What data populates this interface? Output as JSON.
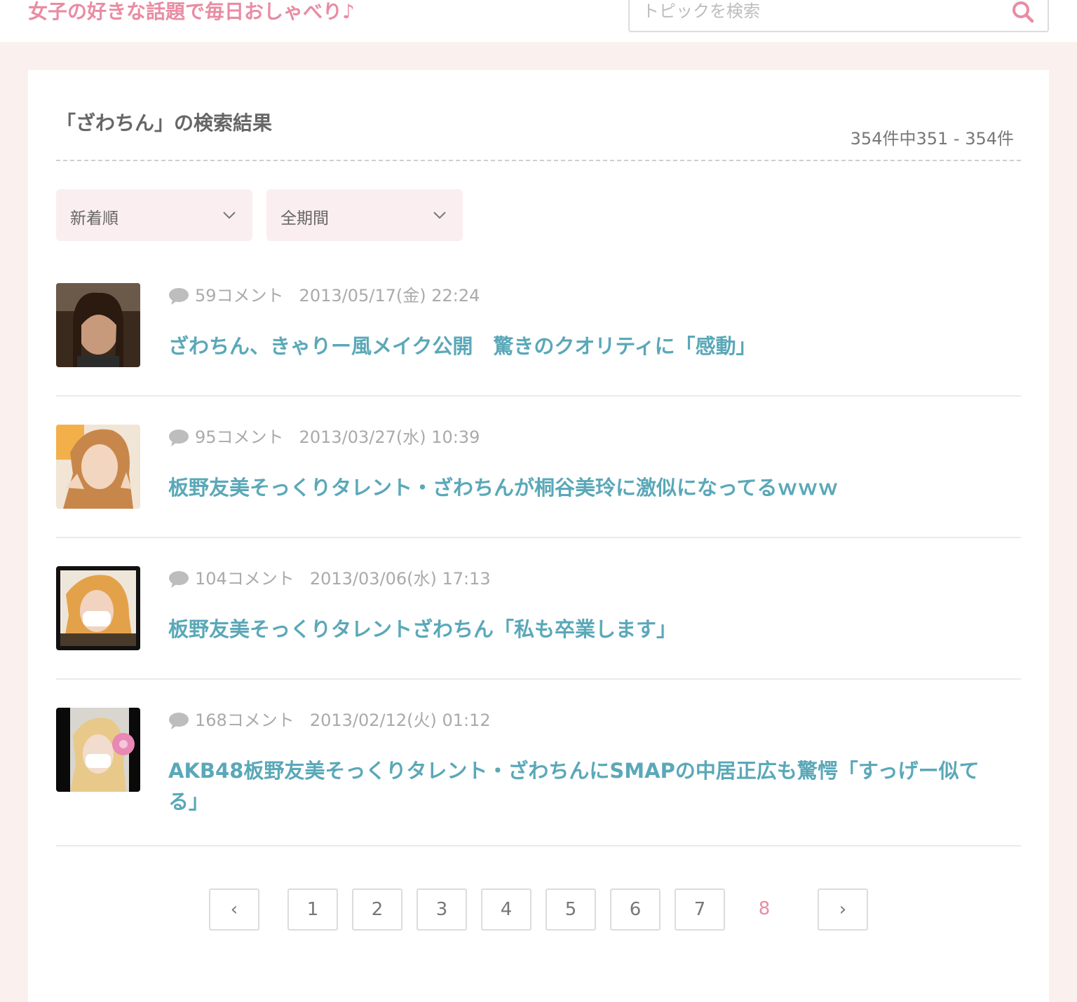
{
  "header": {
    "tagline": "女子の好きな話題で毎日おしゃべり♪",
    "search_placeholder": "トピックを検索",
    "search_icon": "search-icon"
  },
  "results": {
    "title": "「ざわちん」の検索結果",
    "count": "354件中351 - 354件"
  },
  "filters": {
    "sort": "新着順",
    "period": "全期間"
  },
  "items": [
    {
      "comments": "59コメント",
      "date": "2013/05/17(金) 22:24",
      "title": "ざわちん、きゃりー風メイク公開　驚きのクオリティに「感動」"
    },
    {
      "comments": "95コメント",
      "date": "2013/03/27(水) 10:39",
      "title": "板野友美そっくりタレント・ざわちんが桐谷美玲に激似になってるｗｗｗ"
    },
    {
      "comments": "104コメント",
      "date": "2013/03/06(水) 17:13",
      "title": "板野友美そっくりタレントざわちん「私も卒業します」"
    },
    {
      "comments": "168コメント",
      "date": "2013/02/12(火) 01:12",
      "title": "AKB48板野友美そっくりタレント・ざわちんにSMAPの中居正広も驚愕「すっげー似てる」"
    }
  ],
  "pagination": {
    "prev": "‹",
    "next": "›",
    "pages": [
      "1",
      "2",
      "3",
      "4",
      "5",
      "6",
      "7"
    ],
    "current": "8"
  },
  "colors": {
    "accent_pink": "#e98ca3",
    "link_teal": "#5aa8b8",
    "background": "#faf1ee",
    "select_bg": "#fbeef1"
  }
}
